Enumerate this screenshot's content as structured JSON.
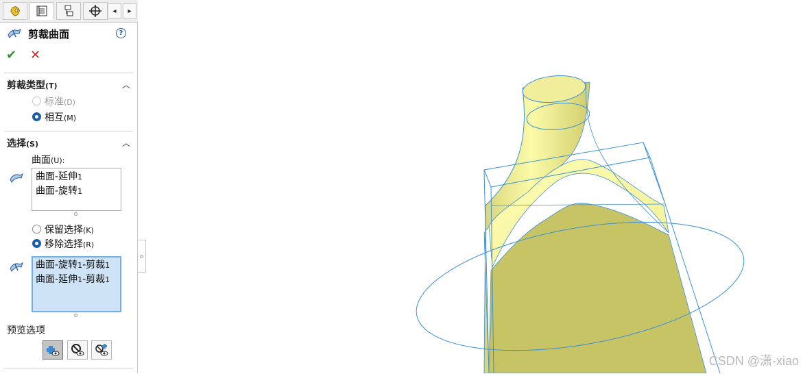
{
  "feature": {
    "title": "剪裁曲面",
    "help_label": "?",
    "ok_glyph": "✔",
    "cancel_glyph": "✕"
  },
  "tabs": [
    {
      "icon": "feature-manager-icon"
    },
    {
      "icon": "property-manager-icon",
      "active": true
    },
    {
      "icon": "configuration-manager-icon"
    },
    {
      "icon": "dimxpert-icon"
    }
  ],
  "tab_arrows": {
    "left": "◂",
    "right": "▸"
  },
  "trim_type": {
    "title": "剪裁类型",
    "shortcut": "(T)",
    "options": [
      {
        "label": "标准",
        "shortcut": "(D)",
        "selected": false,
        "enabled": false
      },
      {
        "label": "相互",
        "shortcut": "(M)",
        "selected": true,
        "enabled": true
      }
    ]
  },
  "selections": {
    "title": "选择",
    "shortcut": "(S)",
    "surfaces_label": "曲面",
    "surfaces_shortcut": "(U):",
    "surfaces": [
      {
        "name": "曲面-延伸",
        "num": "1"
      },
      {
        "name": "曲面-旋转",
        "num": "1"
      }
    ],
    "options": [
      {
        "label": "保留选择",
        "shortcut": "(K)",
        "selected": false
      },
      {
        "label": "移除选择",
        "shortcut": "(R)",
        "selected": true
      }
    ],
    "pieces": [
      {
        "a": "曲面-旋转",
        "n1": "1",
        "b": "-剪裁",
        "n2": "1"
      },
      {
        "a": "曲面-延伸",
        "n1": "1",
        "b": "-剪裁",
        "n2": "1"
      }
    ]
  },
  "preview": {
    "title": "预览选项",
    "buttons": [
      {
        "icon": "show-included-icon",
        "active": true
      },
      {
        "icon": "show-excluded-icon",
        "active": false
      },
      {
        "icon": "show-both-icon",
        "active": false
      }
    ]
  },
  "colors": {
    "surface_fill": "#c7c465",
    "surface_light": "#fbfba8",
    "edge_blue": "#3b8fd8",
    "accent": "#1b5fa8"
  },
  "watermark": "CSDN @潇-xiao"
}
